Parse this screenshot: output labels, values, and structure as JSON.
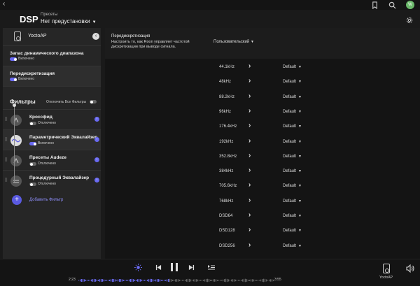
{
  "topbar": {
    "back_icon": "back-arrow-icon",
    "avatar_initials": "W"
  },
  "header": {
    "title": "DSP",
    "presets_label": "Пресеты",
    "preset_value": "Нет предустановки"
  },
  "sidebar": {
    "device_name": "YoctoAP",
    "sections": [
      {
        "title": "Запас динамического диапазона",
        "state": "Включено",
        "enabled": true
      },
      {
        "title": "Передискретизация",
        "state": "Включено",
        "enabled": true
      }
    ],
    "filters_title": "Фильтры",
    "bypass_label": "Отключить Все Фильтры",
    "filters": [
      {
        "name": "Кроссфид",
        "state": "Отключено",
        "enabled": false
      },
      {
        "name": "Параметрический Эквалайзер",
        "state": "Включено",
        "enabled": true
      },
      {
        "name": "Пресеты Audeze",
        "state": "Отключено",
        "enabled": false
      },
      {
        "name": "Процедурный Эквалайзер",
        "state": "Отключено",
        "enabled": false
      }
    ],
    "add_filter_label": "Добавить Фильтр"
  },
  "main": {
    "title": "Передискретизация",
    "description": "Настроить то, как Roon управляет частотой дискретизации при выводе сигнала.",
    "mode_value": "Пользовательский",
    "rates": [
      {
        "name": "44.1kHz",
        "value": "Default"
      },
      {
        "name": "48kHz",
        "value": "Default"
      },
      {
        "name": "88.2kHz",
        "value": "Default"
      },
      {
        "name": "96kHz",
        "value": "Default"
      },
      {
        "name": "176.4kHz",
        "value": "Default"
      },
      {
        "name": "192kHz",
        "value": "Default"
      },
      {
        "name": "352.8kHz",
        "value": "Default"
      },
      {
        "name": "384kHz",
        "value": "Default"
      },
      {
        "name": "705.6kHz",
        "value": "Default"
      },
      {
        "name": "768kHz",
        "value": "Default"
      },
      {
        "name": "DSD64",
        "value": "Default"
      },
      {
        "name": "DSD128",
        "value": "Default"
      },
      {
        "name": "DSD256",
        "value": "Default"
      }
    ]
  },
  "player": {
    "elapsed": "2:23",
    "total": "3:55",
    "zone_name": "YoctoAP"
  },
  "colors": {
    "accent": "#6a6af2",
    "background": "#1a1a1a",
    "panel": "#262626"
  }
}
